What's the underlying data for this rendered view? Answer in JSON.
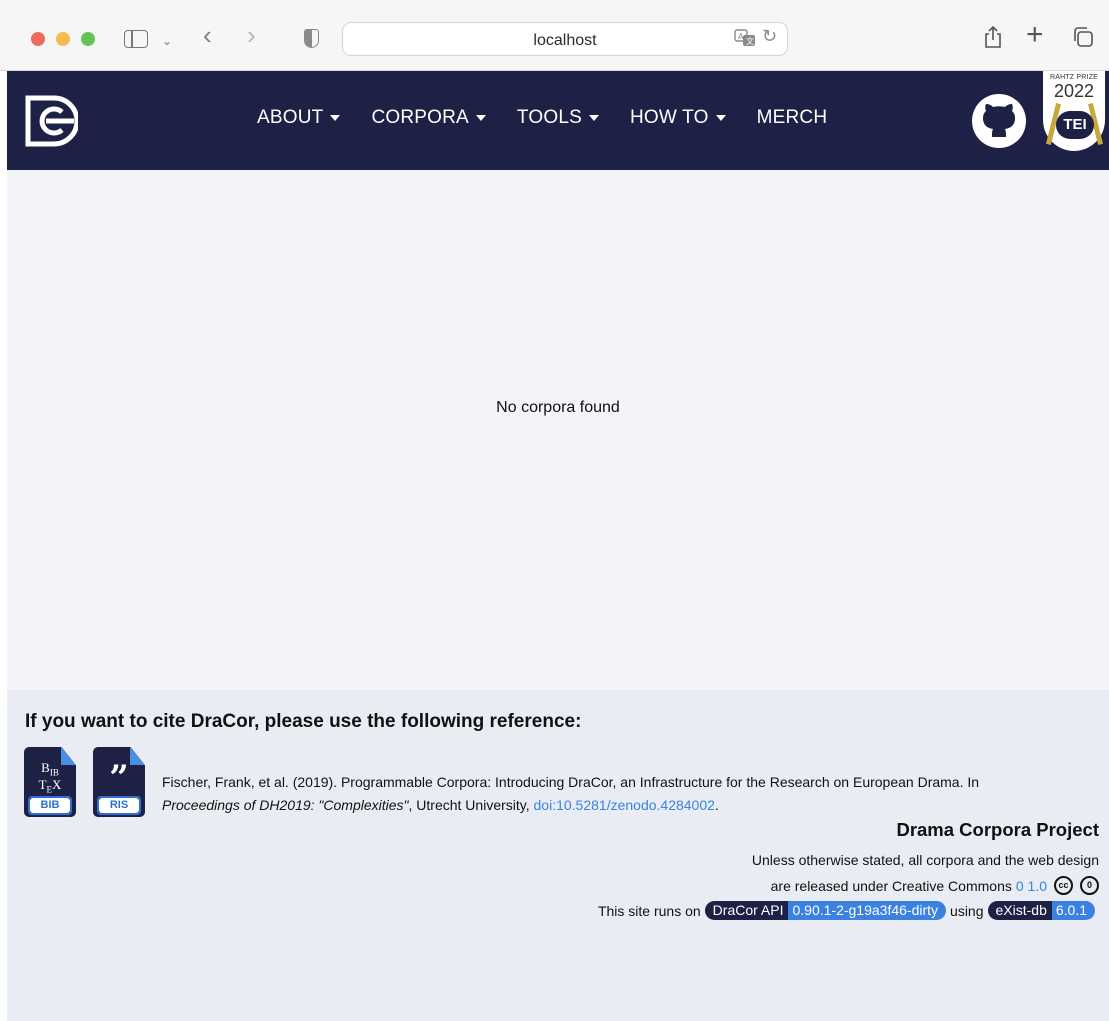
{
  "browser": {
    "url": "localhost"
  },
  "nav": {
    "items": [
      {
        "label": "ABOUT",
        "dropdown": true
      },
      {
        "label": "CORPORA",
        "dropdown": true
      },
      {
        "label": "TOOLS",
        "dropdown": true
      },
      {
        "label": "HOW TO",
        "dropdown": true
      },
      {
        "label": "MERCH",
        "dropdown": false
      }
    ],
    "badge": {
      "prize": "RAHTZ PRIZE",
      "year": "2022",
      "label": "TEI"
    }
  },
  "main": {
    "empty_message": "No corpora found"
  },
  "footer": {
    "cite_heading": "If you want to cite DraCor, please use the following reference:",
    "downloads": {
      "bib_tag": "BIB",
      "ris_tag": "RIS",
      "bib_glyph": "BIB TEX",
      "ris_glyph": "”"
    },
    "citation": {
      "text": "Fischer, Frank, et al. (2019). Programmable Corpora: Introducing DraCor, an Infrastructure for the Research on European Drama. In",
      "venue": "Proceedings of DH2019: \"Complexities\"",
      "place": ", Utrecht University, ",
      "doi": "doi:10.5281/zenodo.4284002",
      "end": "."
    },
    "project_title": "Drama Corpora Project",
    "license_line1": "Unless otherwise stated, all corpora and the web design",
    "license_line2": "are released under Creative Commons",
    "license_link": "0 1.0",
    "runs_on_prefix": "This site runs on",
    "using": "using",
    "api_name": "DraCor API",
    "api_version": "0.90.1-2-g19a3f46-dirty",
    "db_name": "eXist-db",
    "db_version": "6.0.1"
  },
  "colors": {
    "navbar": "#1e2146",
    "accent": "#3b82e0",
    "main_bg": "#f2f4f7",
    "footer_bg": "#e9edf3"
  }
}
